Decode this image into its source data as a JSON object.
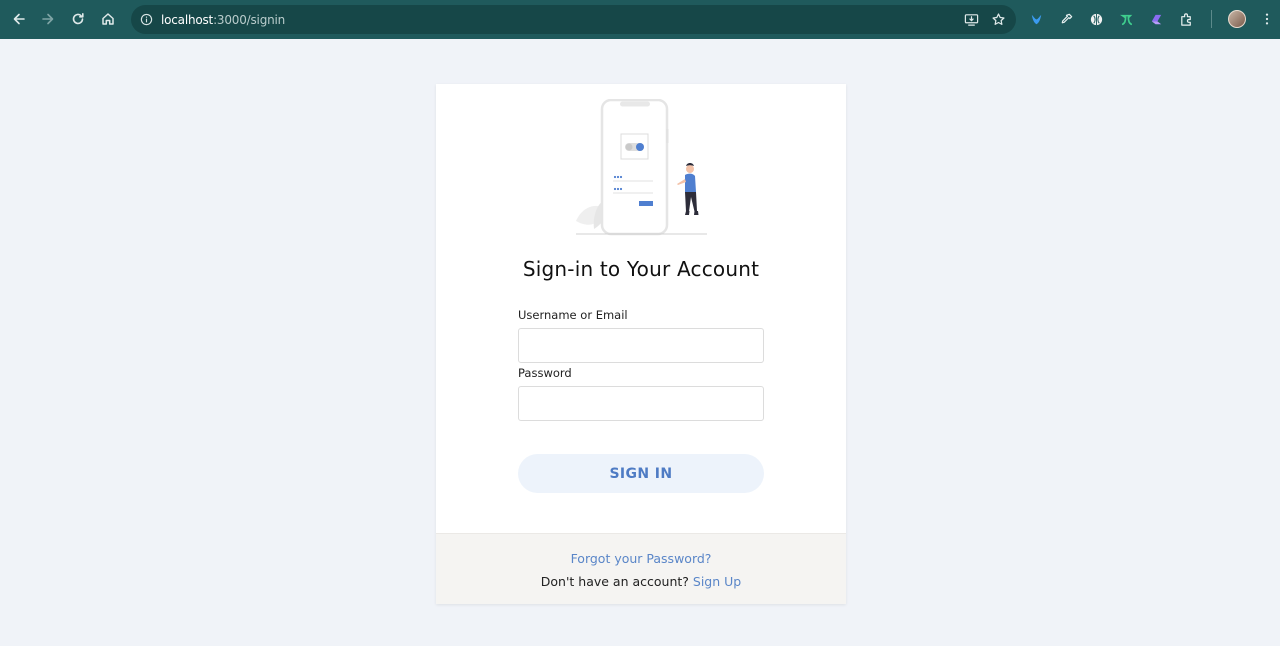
{
  "browser": {
    "url_host": "localhost",
    "url_path": ":3000/signin"
  },
  "card": {
    "title": "Sign-in to Your Account",
    "username_label": "Username or Email",
    "username_value": "",
    "password_label": "Password",
    "password_value": "",
    "signin_button": "SIGN IN",
    "forgot_link": "Forgot your Password?",
    "no_account_text": "Don't have an account?",
    "signup_link": "Sign Up"
  },
  "colors": {
    "chrome_bg": "#1f5a5c",
    "page_bg": "#f0f3f8",
    "accent": "#5a86c8",
    "button_bg": "#edf3fb"
  },
  "icons": [
    "back-arrow-icon",
    "forward-arrow-icon",
    "reload-icon",
    "home-icon",
    "site-info-icon",
    "install-app-icon",
    "bookmark-star-icon",
    "extension-icon",
    "eyedropper-icon",
    "extension-icon",
    "extension-icon",
    "extension-icon",
    "puzzle-icon",
    "profile-avatar",
    "kebab-menu-icon"
  ]
}
